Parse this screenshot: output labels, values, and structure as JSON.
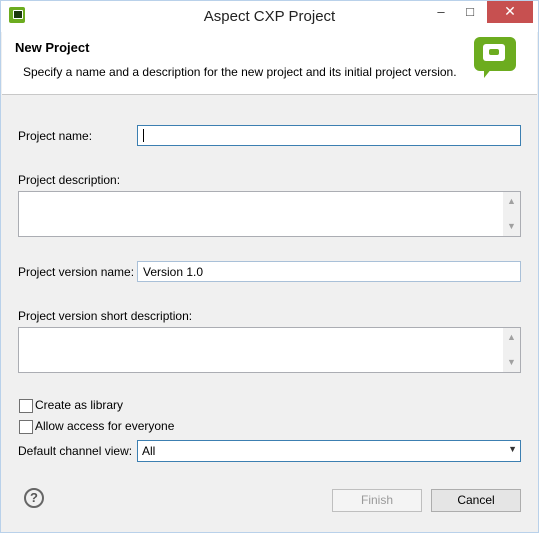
{
  "window": {
    "title": "Aspect CXP Project"
  },
  "banner": {
    "title": "New Project",
    "description": "Specify a name and a description for the new project and its initial project version."
  },
  "form": {
    "project_name_label": "Project name:",
    "project_name_value": "",
    "project_description_label": "Project description:",
    "project_version_name_label": "Project version name:",
    "project_version_name_value": "Version 1.0",
    "project_version_short_description_label": "Project version short description:",
    "create_as_library_label": "Create as library",
    "create_as_library_checked": false,
    "allow_access_label": "Allow access for everyone",
    "allow_access_checked": false,
    "default_channel_view_label": "Default channel view:",
    "default_channel_view_value": "All"
  },
  "footer": {
    "finish_label": "Finish",
    "cancel_label": "Cancel"
  },
  "icons": {
    "app": "aspect-cxp-app-icon",
    "banner": "speech-bubble-icon",
    "help": "help-icon"
  },
  "colors": {
    "brand_green": "#6cac1f",
    "close_button": "#c75050",
    "focus_border": "#3c7fb1"
  }
}
